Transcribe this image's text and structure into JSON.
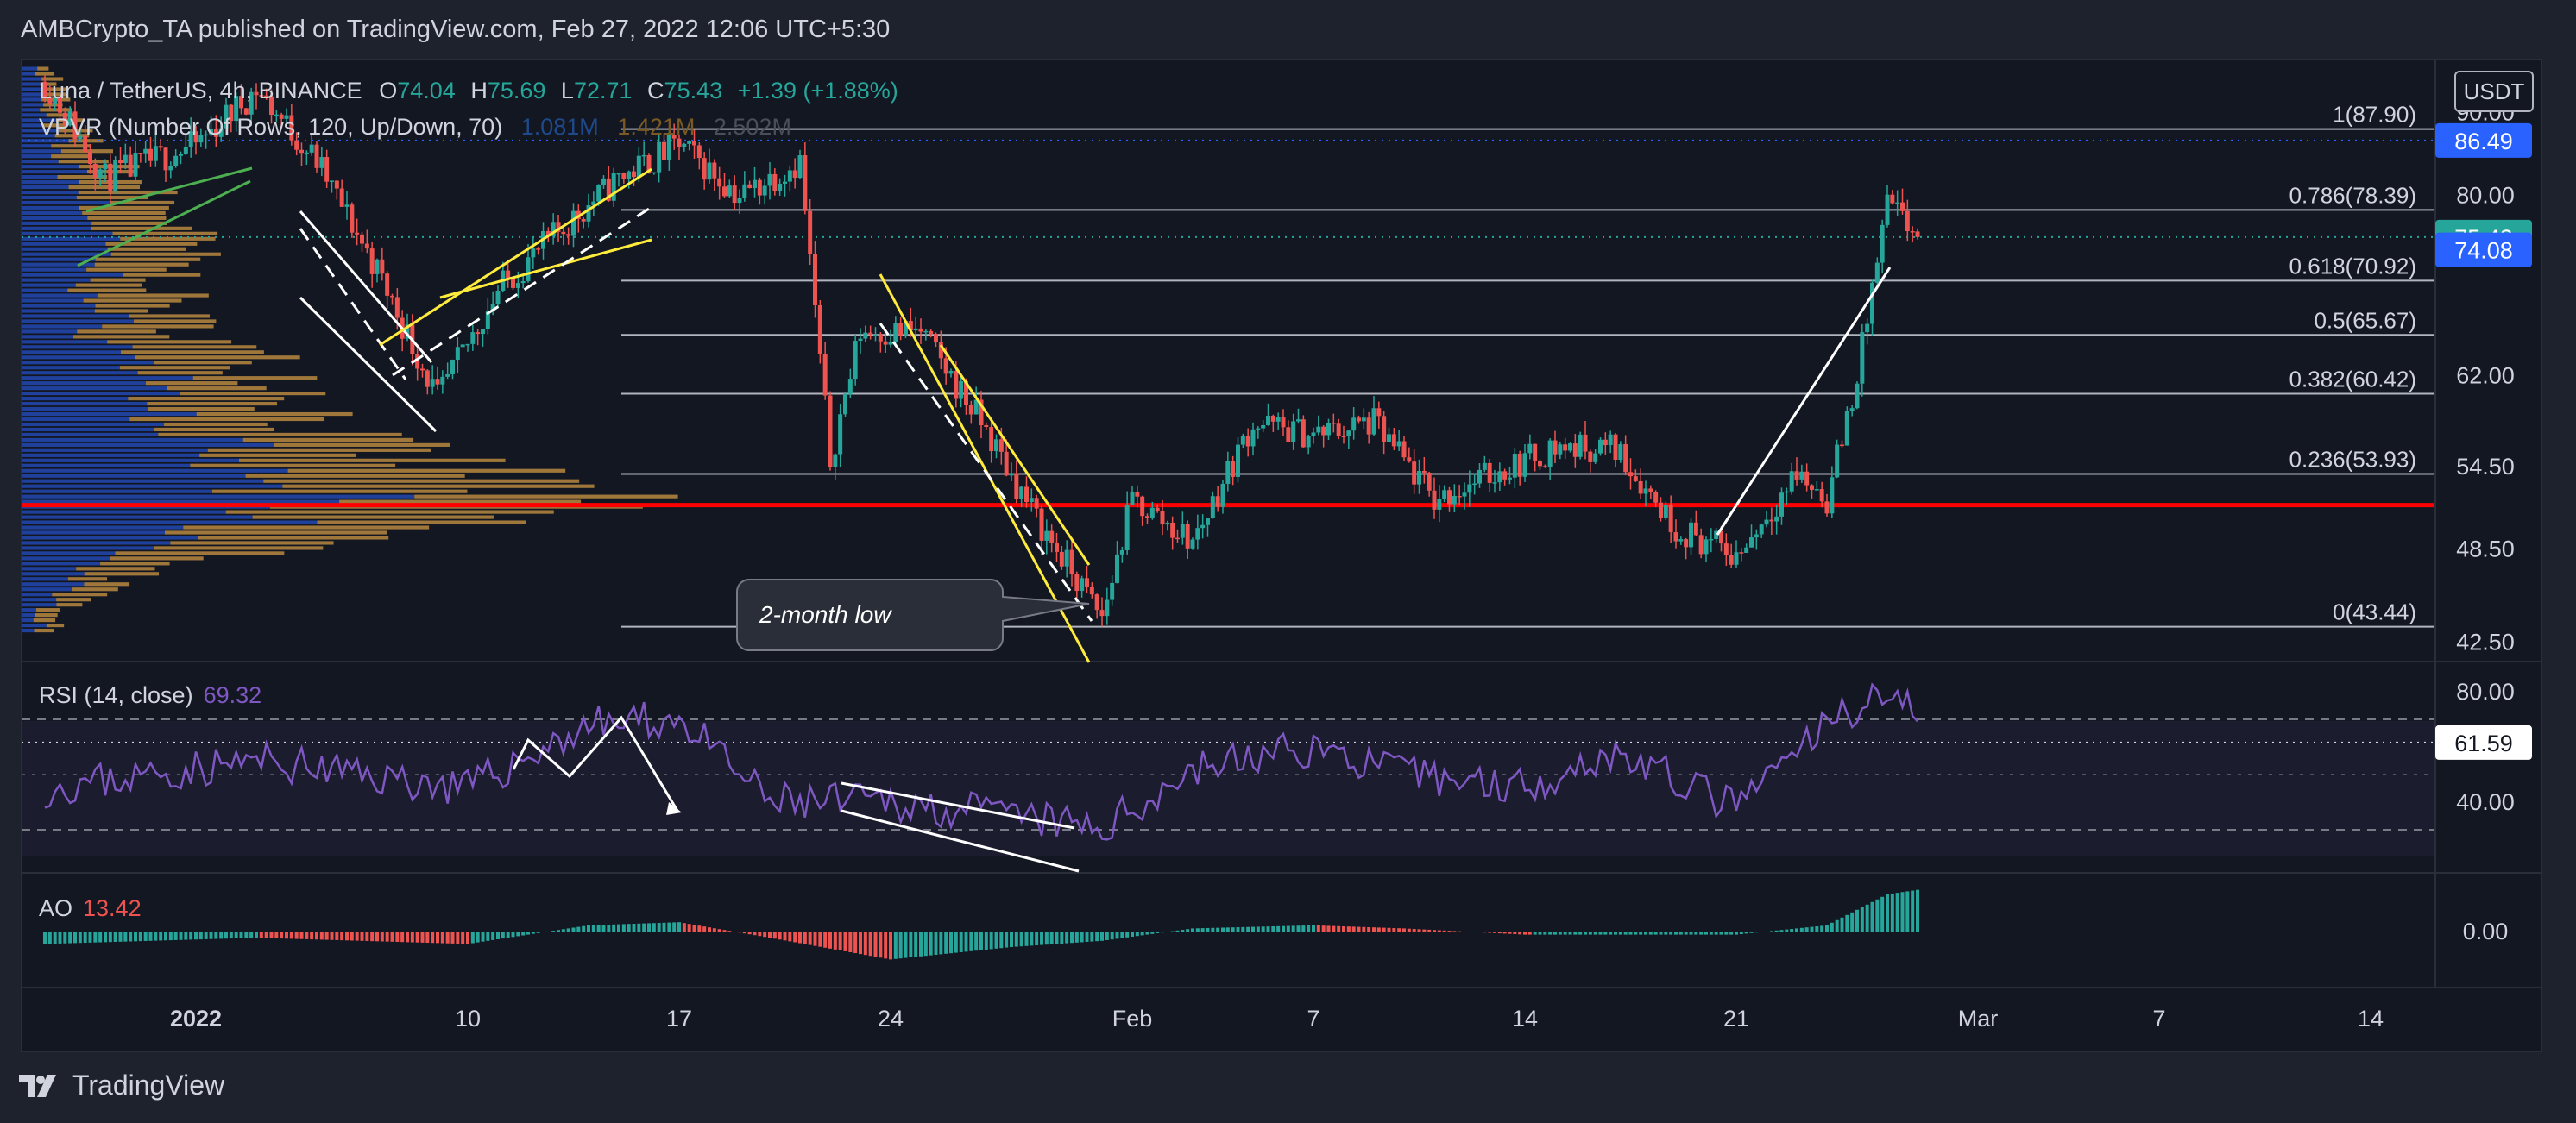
{
  "header": {
    "publisher_line": "AMBCrypto_TA published on TradingView.com, Feb 27, 2022 12:06 UTC+5:30"
  },
  "footer": {
    "brand": "TradingView"
  },
  "currency_badge": "USDT",
  "legend": {
    "symbol": "Luna / TetherUS, 4h, BINANCE",
    "o_label": "O",
    "o_value": "74.04",
    "h_label": "H",
    "h_value": "75.69",
    "l_label": "L",
    "l_value": "72.71",
    "c_label": "C",
    "c_value": "75.43",
    "change": "+1.39 (+1.88%)",
    "vpvr_label": "VPVR (Number Of Rows, 120, Up/Down, 70)",
    "vpvr_up": "1.081M",
    "vpvr_down": "1.421M",
    "vpvr_total": "2.502M"
  },
  "rsi_legend": {
    "label": "RSI (14, close)",
    "value": "69.32"
  },
  "ao_legend": {
    "label": "AO",
    "value": "13.42"
  },
  "annotation": "2-month low",
  "colors": {
    "background": "#131722",
    "up": "#26a69a",
    "down": "#ef5350",
    "support": "#ff0000",
    "channel": "#ffeb3b",
    "rsi_line": "#7e57c2",
    "vp_up": "#2962ff",
    "vp_down": "#ffb74d",
    "badge_blue": "#2962ff",
    "badge_green": "#26a69a"
  },
  "chart_data": [
    {
      "type": "candlestick",
      "title": "Luna / TetherUS, 4h, BINANCE",
      "x_ticks": [
        "2022",
        "10",
        "17",
        "24",
        "Feb",
        "7",
        "14",
        "21",
        "Mar",
        "7",
        "14"
      ],
      "y_ticks": [
        "90.00",
        "80.00",
        "62.00",
        "54.50",
        "48.50",
        "42.50"
      ],
      "scale": "log",
      "ylim": [
        41.5,
        97
      ],
      "price_badges": [
        {
          "value": "86.49"
        },
        {
          "value": "75.43"
        },
        {
          "value": "74.08"
        }
      ],
      "fib_levels": [
        {
          "label": "1(87.90)",
          "value": 87.9
        },
        {
          "label": "0.786(78.39)",
          "value": 78.39
        },
        {
          "label": "0.618(70.92)",
          "value": 70.92
        },
        {
          "label": "0.5(65.67)",
          "value": 65.67
        },
        {
          "label": "0.382(60.42)",
          "value": 60.42
        },
        {
          "label": "0.236(53.93)",
          "value": 53.93
        },
        {
          "label": "0(43.44)",
          "value": 43.44
        }
      ],
      "support_level": 51.6,
      "close_path": [
        [
          "Dec 27",
          94
        ],
        [
          "Dec 29",
          82
        ],
        [
          "Jan 1",
          86
        ],
        [
          "Jan 3",
          93
        ],
        [
          "Jan 5",
          84
        ],
        [
          "Jan 7",
          72
        ],
        [
          "Jan 9",
          60
        ],
        [
          "Jan 11",
          70
        ],
        [
          "Jan 13",
          76
        ],
        [
          "Jan 15",
          82
        ],
        [
          "Jan 17",
          86
        ],
        [
          "Jan 19",
          80
        ],
        [
          "Jan 21",
          84
        ],
        [
          "Jan 22",
          55
        ],
        [
          "Jan 23",
          66
        ],
        [
          "Jan 25",
          66
        ],
        [
          "Jan 27",
          58
        ],
        [
          "Jan 29",
          50
        ],
        [
          "Jan 31",
          44
        ],
        [
          "Feb 1",
          52
        ],
        [
          "Feb 3",
          49
        ],
        [
          "Feb 5",
          58
        ],
        [
          "Feb 7",
          57
        ],
        [
          "Feb 9",
          58
        ],
        [
          "Feb 11",
          52
        ],
        [
          "Feb 13",
          54
        ],
        [
          "Feb 15",
          56
        ],
        [
          "Feb 17",
          56
        ],
        [
          "Feb 19",
          50
        ],
        [
          "Feb 21",
          48
        ],
        [
          "Feb 23",
          54
        ],
        [
          "Feb 24",
          52
        ],
        [
          "Feb 25",
          62
        ],
        [
          "Feb 26",
          79
        ],
        [
          "Feb 27",
          75.43
        ]
      ]
    },
    {
      "type": "line",
      "title": "RSI (14, close)",
      "y_ticks": [
        "80.00",
        "40.00"
      ],
      "current_value_badge": "61.59",
      "bands": [
        70,
        50,
        30
      ],
      "values_by_week": [
        [
          "Dec 27",
          45
        ],
        [
          "Jan 3",
          55
        ],
        [
          "Jan 10",
          45
        ],
        [
          "Jan 14",
          68
        ],
        [
          "Jan 17",
          70
        ],
        [
          "Jan 20",
          40
        ],
        [
          "Jan 24",
          40
        ],
        [
          "Jan 28",
          35
        ],
        [
          "Jan 31",
          30
        ],
        [
          "Feb 3",
          52
        ],
        [
          "Feb 7",
          60
        ],
        [
          "Feb 10",
          50
        ],
        [
          "Feb 14",
          46
        ],
        [
          "Feb 17",
          58
        ],
        [
          "Feb 21",
          38
        ],
        [
          "Feb 24",
          68
        ],
        [
          "Feb 26",
          82
        ],
        [
          "Feb 27",
          69.32
        ]
      ]
    },
    {
      "type": "histogram",
      "title": "AO",
      "y_ticks": [
        "0.00"
      ],
      "values_by_week": [
        [
          "Dec 27",
          -4
        ],
        [
          "Jan 3",
          -2
        ],
        [
          "Jan 10",
          -4
        ],
        [
          "Jan 14",
          2
        ],
        [
          "Jan 17",
          3
        ],
        [
          "Jan 20",
          -2
        ],
        [
          "Jan 24",
          -9
        ],
        [
          "Jan 28",
          -5
        ],
        [
          "Jan 31",
          -3
        ],
        [
          "Feb 3",
          1
        ],
        [
          "Feb 7",
          2
        ],
        [
          "Feb 10",
          1
        ],
        [
          "Feb 14",
          -1
        ],
        [
          "Feb 17",
          -1
        ],
        [
          "Feb 21",
          -1
        ],
        [
          "Feb 24",
          2
        ],
        [
          "Feb 26",
          12
        ],
        [
          "Feb 27",
          13.42
        ]
      ]
    }
  ]
}
